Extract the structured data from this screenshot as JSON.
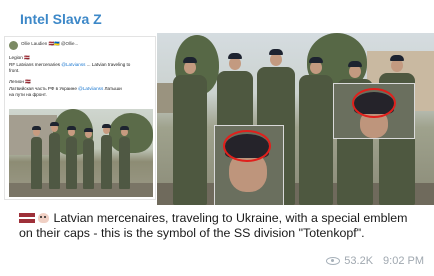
{
  "channel": {
    "name": "Intel Slava Z"
  },
  "tweet": {
    "author": "Ollie Laudien 🇱🇻🇺🇦 @Ollie...",
    "lines": [
      {
        "pre": "Legion 🇱🇻",
        "mention": ""
      },
      {
        "pre": "RF Latvians mercenaries ",
        "mention": "@Latvianss",
        "post": " ... Latvian traveling to"
      },
      {
        "pre": "front.",
        "mention": ""
      },
      {
        "pre": "Легион 🇱🇻",
        "mention": ""
      },
      {
        "pre": "Латвийская часть РФ в Украине ",
        "mention": "@Latviianss",
        "post": " Латыши"
      },
      {
        "pre": "на пути на фронт.",
        "mention": ""
      }
    ]
  },
  "post": {
    "caption": "Latvian mercenaires, traveling to Ukraine, with a special emblem on their caps - this is the symbol of the SS division \"Totenkopf\".",
    "flag_emoji": "latvia-flag",
    "extra_emoji": "skull-face"
  },
  "meta": {
    "views": "53.2K",
    "time": "9:02 PM"
  },
  "colors": {
    "channel": "#3d88c8",
    "background": "#dfe5d3",
    "ring": "#e0201c"
  }
}
